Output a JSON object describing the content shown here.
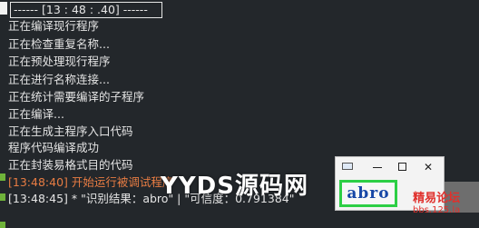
{
  "log": {
    "header": "------ [13 : 48 : .40] ------",
    "lines": [
      "正在编译现行程序",
      "正在检查重复名称...",
      "正在预处理现行程序",
      "正在进行名称连接...",
      "正在统计需要编译的子程序",
      "正在编译...",
      "正在生成主程序入口代码",
      "程序代码编译成功",
      "正在封装易格式目的代码",
      "[13:48:40] 开始运行被调试程序",
      "[13:48:45] * \"识别结果：abro\" | \"可信度：0.791384\""
    ]
  },
  "watermark": "YYDS源码网",
  "dialog": {
    "captcha_text": "abro"
  },
  "forum": {
    "name": "精易论坛",
    "url": "bbs.125.la"
  },
  "colors": {
    "background": "#23272b",
    "text": "#e4e4e4",
    "highlight": "#e77c43",
    "captcha_border": "#2dcf45",
    "captcha_text": "#1747a6",
    "forum": "#e0302c"
  }
}
